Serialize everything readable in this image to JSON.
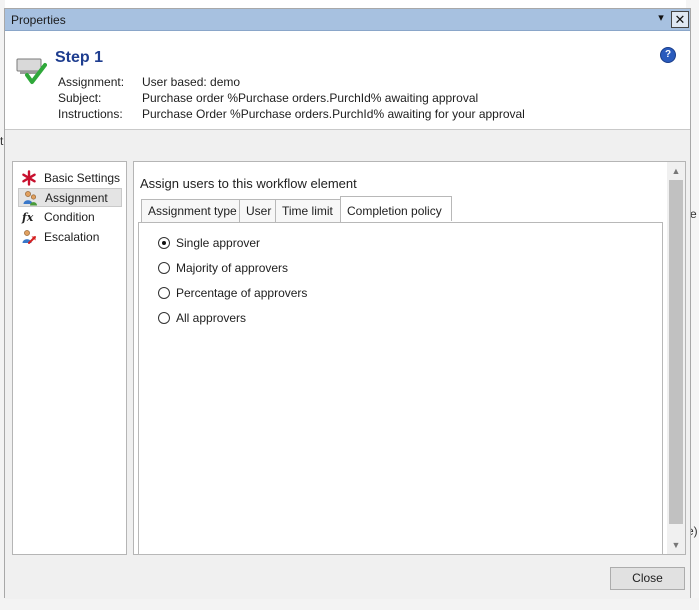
{
  "window": {
    "title": "Properties",
    "menu_glyph": "▾",
    "close_glyph": "✕"
  },
  "background": {
    "left_mark": "t",
    "right_marks": [
      "e",
      "e)"
    ]
  },
  "header": {
    "step_title": "Step 1",
    "help_glyph": "?",
    "rows": [
      {
        "label": "Assignment:",
        "value": "User based: demo"
      },
      {
        "label": "Subject:",
        "value": "Purchase order %Purchase orders.PurchId% awaiting approval"
      },
      {
        "label": "Instructions:",
        "value": "Purchase Order %Purchase orders.PurchId% awaiting for your approval"
      }
    ]
  },
  "nav": {
    "items": [
      {
        "label": "Basic Settings",
        "icon": "asterisk-icon"
      },
      {
        "label": "Assignment",
        "icon": "users-icon",
        "selected": true
      },
      {
        "label": "Condition",
        "icon": "fx-icon"
      },
      {
        "label": "Escalation",
        "icon": "escalation-icon"
      }
    ]
  },
  "main": {
    "title": "Assign users to this workflow element",
    "tabs": [
      {
        "label": "Assignment type"
      },
      {
        "label": "User"
      },
      {
        "label": "Time limit"
      },
      {
        "label": "Completion policy",
        "active": true
      }
    ],
    "radios": [
      {
        "label": "Single approver",
        "checked": true
      },
      {
        "label": "Majority of approvers",
        "checked": false
      },
      {
        "label": "Percentage of approvers",
        "checked": false
      },
      {
        "label": "All approvers",
        "checked": false
      }
    ],
    "scroll_up": "▲",
    "scroll_down": "▼"
  },
  "footer": {
    "close_label": "Close"
  },
  "colors": {
    "titlebar": "#a7c1e0",
    "step_title": "#1e3d8f",
    "help": "#2a5bbd",
    "check": "#2fa83a"
  }
}
